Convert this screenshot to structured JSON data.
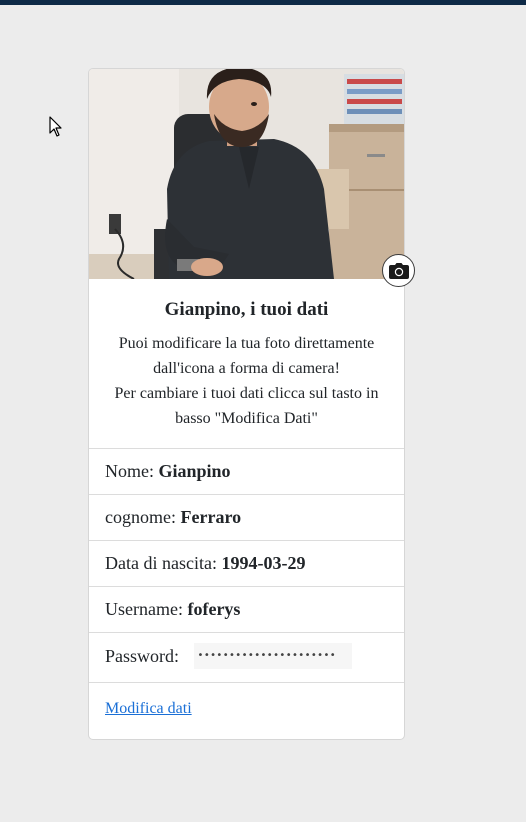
{
  "profile": {
    "photo_alt": "user-photo",
    "camera_icon": "camera-icon",
    "title": "Gianpino, i tuoi dati",
    "description_line1": "Puoi modificare la tua foto direttamente",
    "description_line2": "dall'icona a forma di camera!",
    "description_line3": "Per cambiare i tuoi dati clicca sul tasto in",
    "description_line4": "basso \"Modifica Dati\""
  },
  "fields": {
    "nome_label": "Nome:",
    "nome_value": "Gianpino",
    "cognome_label": "cognome:",
    "cognome_value": "Ferraro",
    "nascita_label": "Data di nascita:",
    "nascita_value": "1994-03-29",
    "username_label": "Username:",
    "username_value": "foferys",
    "password_label": "Password:",
    "password_value": "••••••••••••••••••••••"
  },
  "footer": {
    "edit_link": "Modifica dati"
  },
  "colors": {
    "topbar": "#0e2a47",
    "background": "#ececec",
    "link": "#1a6fd6"
  }
}
